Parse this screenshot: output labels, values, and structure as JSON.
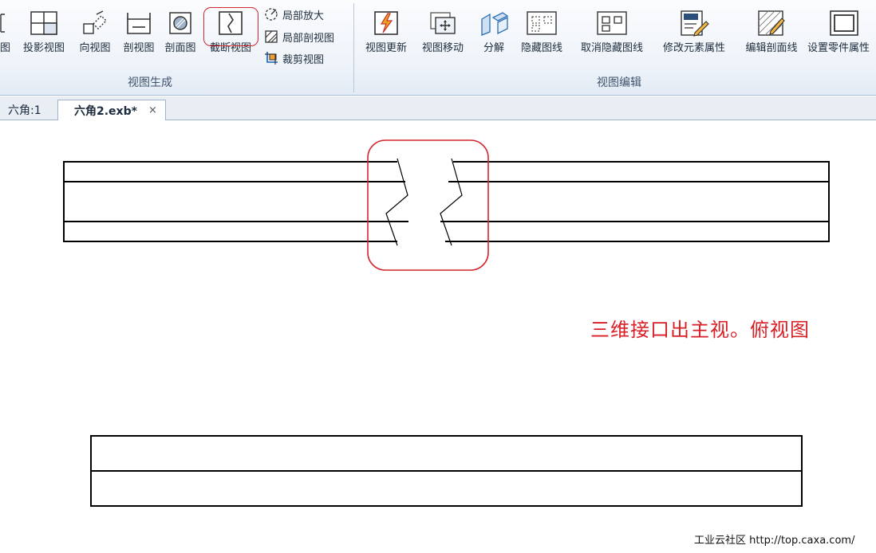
{
  "ribbon": {
    "view_generation": {
      "buttons": [
        {
          "label": "图",
          "icon": "truncated-view-icon"
        },
        {
          "label": "投影视图",
          "icon": "projection-view-icon"
        },
        {
          "label": "向视图",
          "icon": "direction-view-icon"
        },
        {
          "label": "剖视图",
          "icon": "section-view-icon"
        },
        {
          "label": "剖面图",
          "icon": "cross-section-icon"
        },
        {
          "label": "截断视图",
          "icon": "break-view-icon"
        }
      ],
      "small_buttons": [
        {
          "label": "局部放大",
          "icon": "detail-zoom-icon"
        },
        {
          "label": "局部剖视图",
          "icon": "partial-section-icon"
        },
        {
          "label": "裁剪视图",
          "icon": "crop-view-icon"
        }
      ],
      "group_label": "视图生成"
    },
    "view_editing": {
      "buttons": [
        {
          "label": "视图更新",
          "icon": "view-update-icon"
        },
        {
          "label": "视图移动",
          "icon": "view-move-icon"
        },
        {
          "label": "分解",
          "icon": "explode-icon"
        },
        {
          "label": "隐藏图线",
          "icon": "hide-lines-icon"
        },
        {
          "label": "取消隐藏图线",
          "icon": "unhide-lines-icon"
        },
        {
          "label": "修改元素属性",
          "icon": "edit-properties-icon"
        },
        {
          "label": "编辑剖面线",
          "icon": "edit-hatch-icon"
        },
        {
          "label": "设置零件属性",
          "icon": "part-properties-icon"
        }
      ],
      "group_label": "视图编辑"
    }
  },
  "tabs": [
    {
      "label": "六角:1",
      "active": false
    },
    {
      "label": "六角2.exb*",
      "active": true,
      "close": "×"
    }
  ],
  "drawing": {
    "note": "三维接口出主视。俯视图"
  },
  "footer": {
    "watermark": "工业云社区 http://top.caxa.com/"
  },
  "colors": {
    "highlight": "#d2272f",
    "annotation": "#d81f26",
    "drawing_line": "#000000"
  }
}
